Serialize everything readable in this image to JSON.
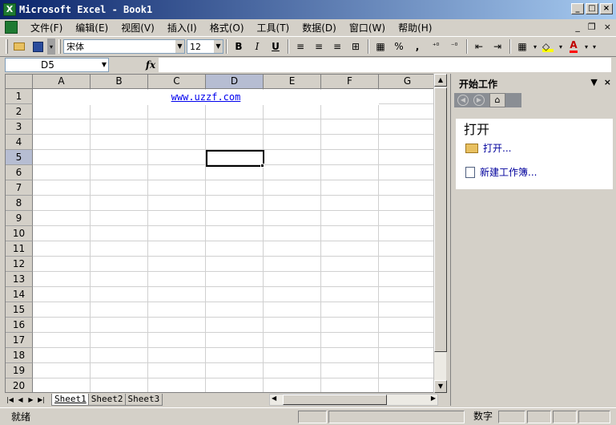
{
  "window": {
    "title": "Microsoft Excel - Book1",
    "app_icon": "X"
  },
  "menu": {
    "items": [
      "文件(F)",
      "编辑(E)",
      "视图(V)",
      "插入(I)",
      "格式(O)",
      "工具(T)",
      "数据(D)",
      "窗口(W)",
      "帮助(H)"
    ]
  },
  "toolbar": {
    "font_name": "宋体",
    "font_size": "12",
    "bold_label": "B",
    "italic_label": "I",
    "underline_label": "U",
    "percent_label": "%",
    "comma_label": ","
  },
  "formula": {
    "name_box": "D5",
    "fx_label": "fx",
    "value": ""
  },
  "sheet": {
    "columns": [
      "A",
      "B",
      "C",
      "D",
      "E",
      "F",
      "G"
    ],
    "rows": [
      "1",
      "2",
      "3",
      "4",
      "5",
      "6",
      "7",
      "8",
      "9",
      "10",
      "11",
      "12",
      "13",
      "14",
      "15",
      "16",
      "17",
      "18",
      "19",
      "20"
    ],
    "active_col": "D",
    "active_row": "5",
    "cell_A1": "www.uzzf.com"
  },
  "tabs": [
    "Sheet1",
    "Sheet2",
    "Sheet3"
  ],
  "active_tab": "Sheet1",
  "status": {
    "ready": "就绪",
    "num": "数字"
  },
  "taskpane": {
    "title": "开始工作",
    "section": "打开",
    "open_link": "打开...",
    "new_link": "新建工作簿..."
  },
  "colors": {
    "title_start": "#0a246a",
    "title_end": "#a6caf0",
    "link": "#0000ee",
    "selected_header": "#b6bdd2"
  }
}
